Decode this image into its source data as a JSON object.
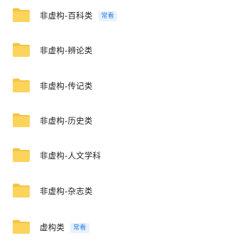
{
  "files": [
    {
      "name": "非虚构-百科类",
      "badge": "常看"
    },
    {
      "name": "非虚构-辨论类",
      "badge": ""
    },
    {
      "name": "非虚构-传记类",
      "badge": ""
    },
    {
      "name": "非虚构-历史类",
      "badge": ""
    },
    {
      "name": "非虚构-人文学科",
      "badge": ""
    },
    {
      "name": "非虚构-杂志类",
      "badge": ""
    },
    {
      "name": "虚构类",
      "badge": "常看"
    }
  ],
  "colors": {
    "folder_back": "#f6c443",
    "folder_front": "#fcd45c",
    "badge_text": "#2f7fe0",
    "badge_bg": "#e8f2fd"
  }
}
